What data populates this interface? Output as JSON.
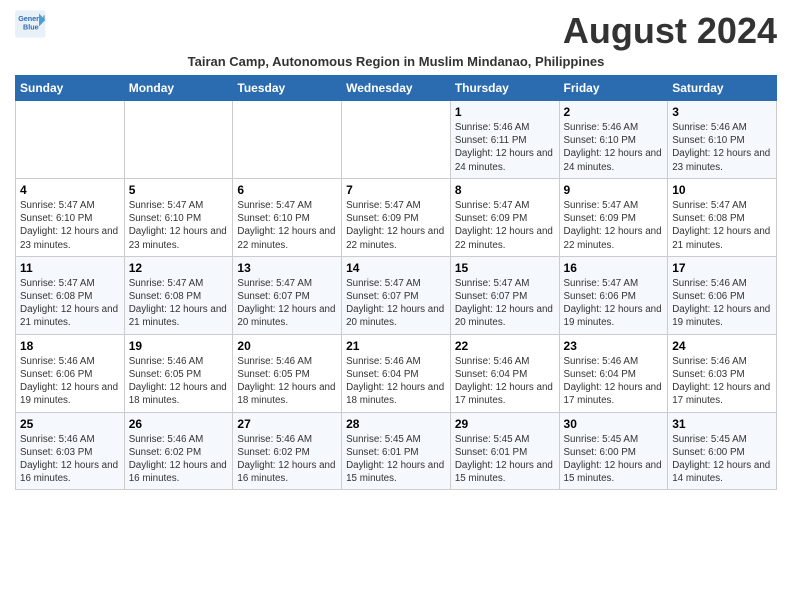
{
  "header": {
    "logo_line1": "General",
    "logo_line2": "Blue",
    "month": "August 2024",
    "subtitle": "Tairan Camp, Autonomous Region in Muslim Mindanao, Philippines"
  },
  "weekdays": [
    "Sunday",
    "Monday",
    "Tuesday",
    "Wednesday",
    "Thursday",
    "Friday",
    "Saturday"
  ],
  "weeks": [
    [
      {
        "day": "",
        "info": ""
      },
      {
        "day": "",
        "info": ""
      },
      {
        "day": "",
        "info": ""
      },
      {
        "day": "",
        "info": ""
      },
      {
        "day": "1",
        "info": "Sunrise: 5:46 AM\nSunset: 6:11 PM\nDaylight: 12 hours and 24 minutes."
      },
      {
        "day": "2",
        "info": "Sunrise: 5:46 AM\nSunset: 6:10 PM\nDaylight: 12 hours and 24 minutes."
      },
      {
        "day": "3",
        "info": "Sunrise: 5:46 AM\nSunset: 6:10 PM\nDaylight: 12 hours and 23 minutes."
      }
    ],
    [
      {
        "day": "4",
        "info": "Sunrise: 5:47 AM\nSunset: 6:10 PM\nDaylight: 12 hours and 23 minutes."
      },
      {
        "day": "5",
        "info": "Sunrise: 5:47 AM\nSunset: 6:10 PM\nDaylight: 12 hours and 23 minutes."
      },
      {
        "day": "6",
        "info": "Sunrise: 5:47 AM\nSunset: 6:10 PM\nDaylight: 12 hours and 22 minutes."
      },
      {
        "day": "7",
        "info": "Sunrise: 5:47 AM\nSunset: 6:09 PM\nDaylight: 12 hours and 22 minutes."
      },
      {
        "day": "8",
        "info": "Sunrise: 5:47 AM\nSunset: 6:09 PM\nDaylight: 12 hours and 22 minutes."
      },
      {
        "day": "9",
        "info": "Sunrise: 5:47 AM\nSunset: 6:09 PM\nDaylight: 12 hours and 22 minutes."
      },
      {
        "day": "10",
        "info": "Sunrise: 5:47 AM\nSunset: 6:08 PM\nDaylight: 12 hours and 21 minutes."
      }
    ],
    [
      {
        "day": "11",
        "info": "Sunrise: 5:47 AM\nSunset: 6:08 PM\nDaylight: 12 hours and 21 minutes."
      },
      {
        "day": "12",
        "info": "Sunrise: 5:47 AM\nSunset: 6:08 PM\nDaylight: 12 hours and 21 minutes."
      },
      {
        "day": "13",
        "info": "Sunrise: 5:47 AM\nSunset: 6:07 PM\nDaylight: 12 hours and 20 minutes."
      },
      {
        "day": "14",
        "info": "Sunrise: 5:47 AM\nSunset: 6:07 PM\nDaylight: 12 hours and 20 minutes."
      },
      {
        "day": "15",
        "info": "Sunrise: 5:47 AM\nSunset: 6:07 PM\nDaylight: 12 hours and 20 minutes."
      },
      {
        "day": "16",
        "info": "Sunrise: 5:47 AM\nSunset: 6:06 PM\nDaylight: 12 hours and 19 minutes."
      },
      {
        "day": "17",
        "info": "Sunrise: 5:46 AM\nSunset: 6:06 PM\nDaylight: 12 hours and 19 minutes."
      }
    ],
    [
      {
        "day": "18",
        "info": "Sunrise: 5:46 AM\nSunset: 6:06 PM\nDaylight: 12 hours and 19 minutes."
      },
      {
        "day": "19",
        "info": "Sunrise: 5:46 AM\nSunset: 6:05 PM\nDaylight: 12 hours and 18 minutes."
      },
      {
        "day": "20",
        "info": "Sunrise: 5:46 AM\nSunset: 6:05 PM\nDaylight: 12 hours and 18 minutes."
      },
      {
        "day": "21",
        "info": "Sunrise: 5:46 AM\nSunset: 6:04 PM\nDaylight: 12 hours and 18 minutes."
      },
      {
        "day": "22",
        "info": "Sunrise: 5:46 AM\nSunset: 6:04 PM\nDaylight: 12 hours and 17 minutes."
      },
      {
        "day": "23",
        "info": "Sunrise: 5:46 AM\nSunset: 6:04 PM\nDaylight: 12 hours and 17 minutes."
      },
      {
        "day": "24",
        "info": "Sunrise: 5:46 AM\nSunset: 6:03 PM\nDaylight: 12 hours and 17 minutes."
      }
    ],
    [
      {
        "day": "25",
        "info": "Sunrise: 5:46 AM\nSunset: 6:03 PM\nDaylight: 12 hours and 16 minutes."
      },
      {
        "day": "26",
        "info": "Sunrise: 5:46 AM\nSunset: 6:02 PM\nDaylight: 12 hours and 16 minutes."
      },
      {
        "day": "27",
        "info": "Sunrise: 5:46 AM\nSunset: 6:02 PM\nDaylight: 12 hours and 16 minutes."
      },
      {
        "day": "28",
        "info": "Sunrise: 5:45 AM\nSunset: 6:01 PM\nDaylight: 12 hours and 15 minutes."
      },
      {
        "day": "29",
        "info": "Sunrise: 5:45 AM\nSunset: 6:01 PM\nDaylight: 12 hours and 15 minutes."
      },
      {
        "day": "30",
        "info": "Sunrise: 5:45 AM\nSunset: 6:00 PM\nDaylight: 12 hours and 15 minutes."
      },
      {
        "day": "31",
        "info": "Sunrise: 5:45 AM\nSunset: 6:00 PM\nDaylight: 12 hours and 14 minutes."
      }
    ]
  ]
}
